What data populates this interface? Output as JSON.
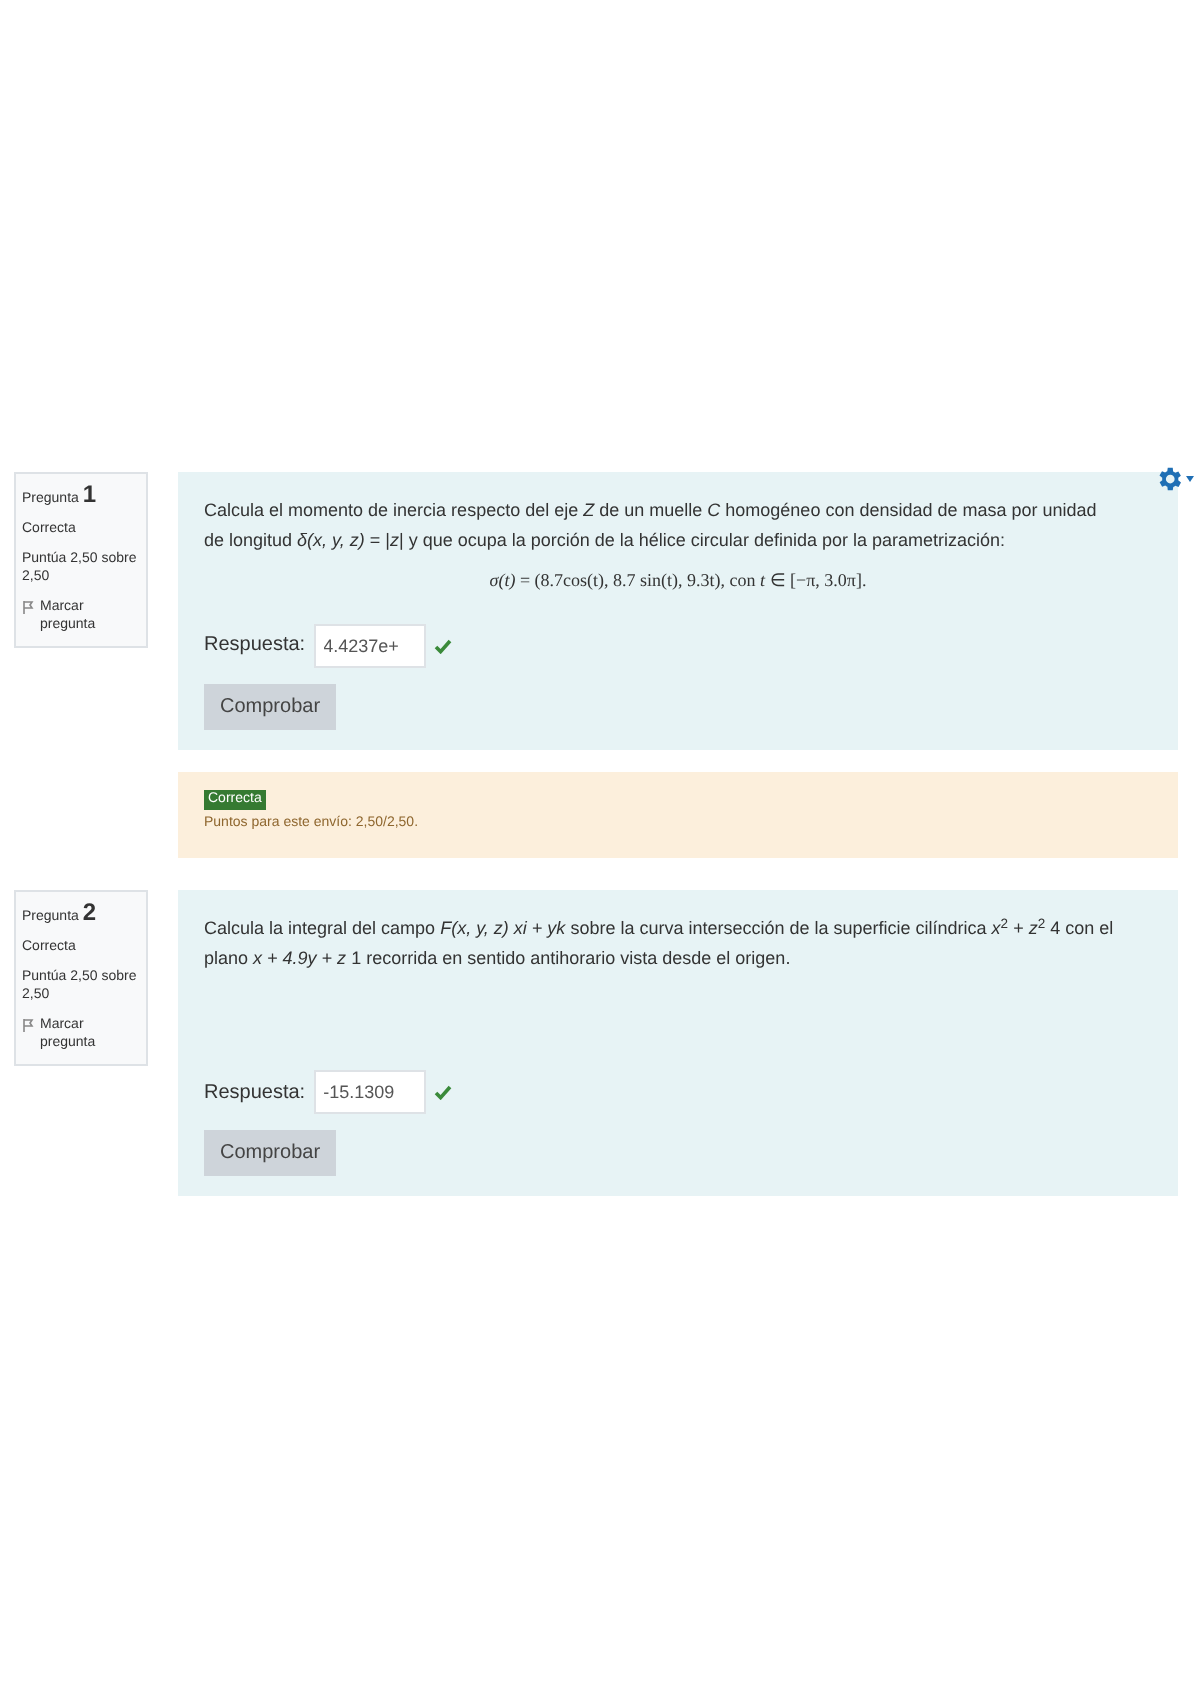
{
  "questions": [
    {
      "number": "1",
      "label": "Pregunta",
      "state": "Correcta",
      "grade": "Puntúa 2,50 sobre 2,50",
      "flag": "Marcar pregunta",
      "settings_menu": true,
      "text": [
        "Calcula el momento de inercia respecto del eje *Z* de un muelle *C* homogéneo con densidad de masa por unidad de longitud *δ(x, y, z)* = |*z*| y que ocupa la porción de la hélice circular definida por la parametrización:"
      ],
      "formula": "*σ(t)* = (8.7cos(t), 8.7 sin(t), 9.3t), con *t* ∈ [−π, 3.0π].",
      "answer_label": "Respuesta:",
      "answer": "4.4237e+",
      "correct": true,
      "button": "Comprobar",
      "feedback": {
        "badge": "Correcta",
        "text": "Puntos para este envío: 2,50/2,50."
      }
    },
    {
      "number": "2",
      "label": "Pregunta",
      "state": "Correcta",
      "grade": "Puntúa 2,50 sobre 2,50",
      "flag": "Marcar pregunta",
      "settings_menu": false,
      "text": [
        "Calcula la integral del campo *F(x, y, z)* *xi + yk* sobre la curva intersección de la superficie cilíndrica *x*$^{2}$ + *z*$^{2}$ 4 con el plano *x + 4.9y + z* 1 recorrida en sentido antihorario vista desde el origen."
      ],
      "answer_label": "Respuesta:",
      "answer": "-15.1309",
      "correct": true,
      "button": "Comprobar"
    }
  ]
}
